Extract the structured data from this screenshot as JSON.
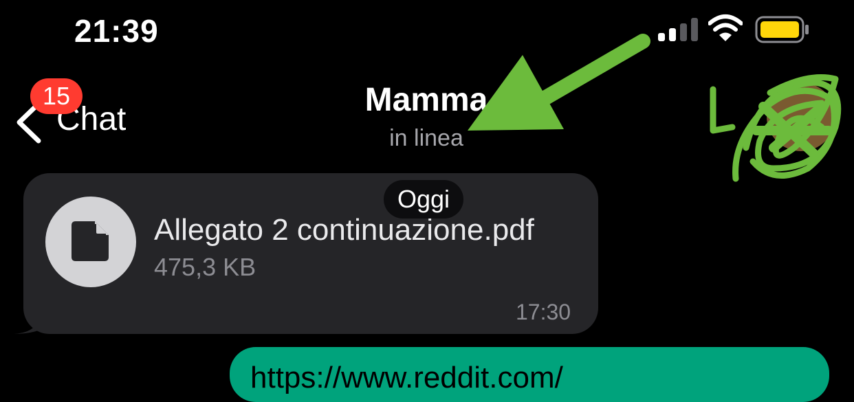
{
  "status_bar": {
    "time": "21:39",
    "battery_color": "#ffd60a",
    "icons": [
      "cellular-signal-icon",
      "wifi-icon",
      "battery-icon"
    ]
  },
  "header": {
    "back_label": "Chat",
    "unread_badge": "15",
    "contact_name": "Mamma",
    "status": "in linea"
  },
  "messages": {
    "date_separator": "Oggi",
    "incoming_file": {
      "file_name": "Allegato 2 continuazione.pdf",
      "file_size": "475,3 KB",
      "time": "17:30"
    },
    "outgoing": {
      "text": "https://www.reddit.com/"
    }
  },
  "colors": {
    "incoming_bubble": "#252528",
    "outgoing_bubble": "#00a37c",
    "badge": "#ff3b30",
    "annotation_green": "#6cbb3c"
  }
}
